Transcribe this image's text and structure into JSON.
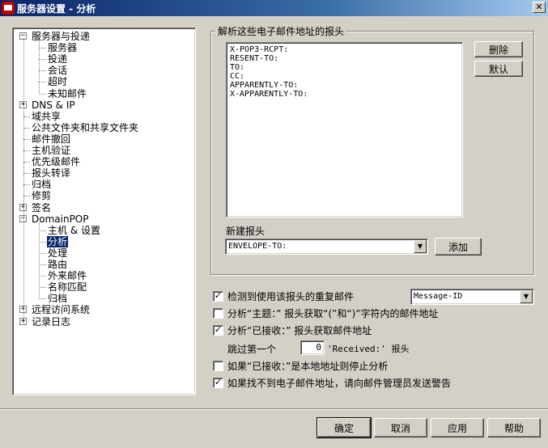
{
  "window": {
    "title": "服务器设置 - 分析",
    "close_glyph": "✕"
  },
  "tree": {
    "items": [
      {
        "label": "服务器与投递",
        "expander": "−"
      },
      {
        "label": "服务器"
      },
      {
        "label": "投递"
      },
      {
        "label": "会话"
      },
      {
        "label": "超时"
      },
      {
        "label": "未知邮件"
      },
      {
        "label": "DNS & IP",
        "expander": "+"
      },
      {
        "label": "域共享"
      },
      {
        "label": "公共文件夹和共享文件夹"
      },
      {
        "label": "邮件撤回"
      },
      {
        "label": "主机验证"
      },
      {
        "label": "优先级邮件"
      },
      {
        "label": "报头转译"
      },
      {
        "label": "归档"
      },
      {
        "label": "修剪"
      },
      {
        "label": "签名",
        "expander": "+"
      },
      {
        "label": "DomainPOP",
        "expander": "−"
      },
      {
        "label": "主机 & 设置"
      },
      {
        "label": "分析",
        "selected": true
      },
      {
        "label": "处理"
      },
      {
        "label": "路由"
      },
      {
        "label": "外来邮件"
      },
      {
        "label": "名称匹配"
      },
      {
        "label": "归档"
      },
      {
        "label": "远程访问系统",
        "expander": "+"
      },
      {
        "label": "记录日志",
        "expander": "+"
      }
    ]
  },
  "parse_group": {
    "title": "解析这些电子邮件地址的报头",
    "headers": [
      "X-POP3-RCPT:",
      "RESENT-TO:",
      "TO:",
      "CC:",
      "APPARENTLY-TO:",
      "X-APPARENTLY-TO:"
    ],
    "delete_label": "删除",
    "default_label": "默认",
    "new_header_label": "新建报头",
    "new_header_value": "ENVELOPE-TO:",
    "add_label": "添加"
  },
  "options": {
    "duplicate": {
      "label": "检测到使用该报头的重复邮件",
      "checked": true,
      "check_glyph": "✓",
      "select_value": "Message-ID"
    },
    "subject": {
      "label": "分析“主题：” 报头获取“(”和“)”字符内的邮件地址",
      "checked": false
    },
    "received": {
      "label": "分析“已接收：” 报头获取邮件地址",
      "checked": true,
      "check_glyph": "✓"
    },
    "skip_prefix": "跳过第一个",
    "skip_value": "0",
    "skip_suffix": "'Received:' 报头",
    "stop_local": {
      "label": "如果“已接收：”是本地地址则停止分析",
      "checked": false
    },
    "warn_admin": {
      "label": "如果找不到电子邮件地址，请向邮件管理员发送警告",
      "checked": true,
      "check_glyph": "✓"
    }
  },
  "footer": {
    "ok_label": "确定",
    "cancel_label": "取消",
    "apply_label": "应用",
    "help_label": "帮助"
  },
  "colors": {
    "face": "#d4d0c8",
    "selection": "#0a246a",
    "title_start": "#0a246a",
    "title_end": "#a6caf0"
  }
}
